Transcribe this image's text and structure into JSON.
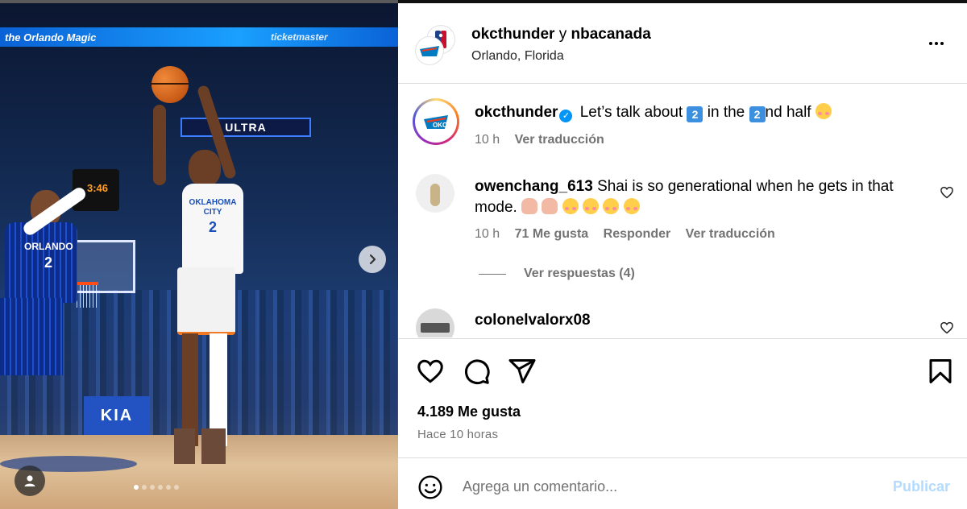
{
  "media": {
    "ribbon_text": "the Orlando Magic",
    "ribbon_text_2": "ticketmaster",
    "board_text": "ULTRA",
    "clock_text": "3:46",
    "sponsor_text": "KIA",
    "player_left_team": "ORLANDO",
    "player_left_number": "2",
    "player_right_team": "OKLAHOMA CITY",
    "player_right_number": "2",
    "next_icon": "chevron-right-icon",
    "tag_icon": "user-tag-icon",
    "slide_count": 6,
    "active_slide": 0
  },
  "header": {
    "account_primary": "okcthunder",
    "joiner": "y",
    "account_secondary": "nbacanada",
    "location": "Orlando, Florida",
    "more_icon": "more-horizontal-icon"
  },
  "caption": {
    "username": "okcthunder",
    "verified": true,
    "text_1": "Let’s talk about",
    "keycap_1": "2",
    "text_2": "in the",
    "keycap_2": "2",
    "text_3": "nd half",
    "time": "10 h",
    "translate": "Ver traducción"
  },
  "comments": [
    {
      "username": "owenchang_613",
      "text": "Shai is so generational when he gets in that mode.",
      "time": "10 h",
      "likes": "71 Me gusta",
      "reply": "Responder",
      "translate": "Ver traducción",
      "view_replies": "Ver respuestas (4)"
    },
    {
      "username": "colonelvalorx08"
    }
  ],
  "actions": {
    "like_icon": "heart-icon",
    "comment_icon": "comment-icon",
    "share_icon": "send-icon",
    "save_icon": "bookmark-icon",
    "likes": "4.189 Me gusta",
    "posted": "Hace 10 horas"
  },
  "composer": {
    "emoji_icon": "emoji-icon",
    "placeholder": "Agrega un comentario...",
    "post_label": "Publicar"
  },
  "colors": {
    "link_blue": "#0095f6",
    "post_disabled": "#b3dbff",
    "muted_text": "#737373",
    "divider": "#dbdbdb"
  }
}
